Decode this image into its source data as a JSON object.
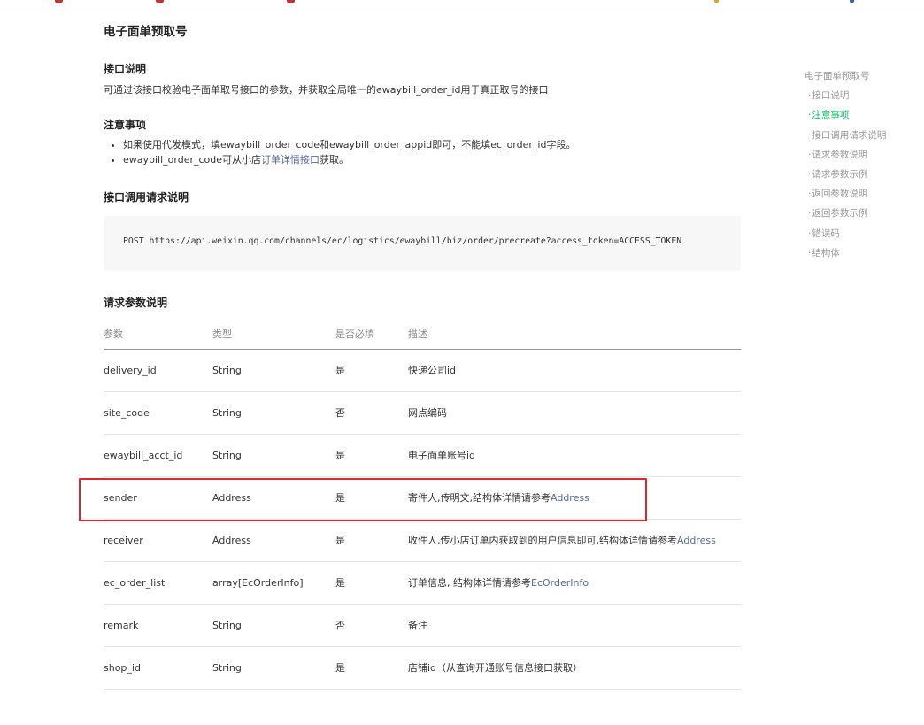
{
  "page": {
    "title": "电子面单预取号"
  },
  "sections": {
    "desc": {
      "heading": "接口说明",
      "text": "可通过该接口校验电子面单取号接口的参数，并获取全局唯一的ewaybill_order_id用于真正取号的接口"
    },
    "notes": {
      "heading": "注意事项",
      "item1": "如果使用代发模式，填ewaybill_order_code和ewaybill_order_appid即可，不能填ec_order_id字段。",
      "item2_prefix": "ewaybill_order_code可从小店",
      "item2_link": "订单详情接口",
      "item2_suffix": "获取。"
    },
    "request": {
      "heading": "接口调用请求说明",
      "code": "POST https://api.weixin.qq.com/channels/ec/logistics/ewaybill/biz/order/precreate?access_token=ACCESS_TOKEN"
    },
    "params": {
      "heading": "请求参数说明",
      "columns": [
        "参数",
        "类型",
        "是否必填",
        "描述"
      ],
      "rows": [
        {
          "name": "delivery_id",
          "type": "String",
          "required": "是",
          "desc": "快递公司id",
          "link": ""
        },
        {
          "name": "site_code",
          "type": "String",
          "required": "否",
          "desc": "网点编码",
          "link": ""
        },
        {
          "name": "ewaybill_acct_id",
          "type": "String",
          "required": "是",
          "desc": "电子面单账号id",
          "link": ""
        },
        {
          "name": "sender",
          "type": "Address",
          "required": "是",
          "desc": "寄件人,传明文,结构体详情请参考",
          "link": "Address"
        },
        {
          "name": "receiver",
          "type": "Address",
          "required": "是",
          "desc": "收件人,传小店订单内获取到的用户信息即可,结构体详情请参考",
          "link": "Address"
        },
        {
          "name": "ec_order_list",
          "type": "array[EcOrderInfo]",
          "required": "是",
          "desc": "订单信息, 结构体详情请参考",
          "link": "EcOrderInfo"
        },
        {
          "name": "remark",
          "type": "String",
          "required": "否",
          "desc": "备注",
          "link": ""
        },
        {
          "name": "shop_id",
          "type": "String",
          "required": "是",
          "desc": "店铺id（从查询开通账号信息接口获取）",
          "link": ""
        }
      ]
    },
    "next_heading": ""
  },
  "toc": {
    "root": "电子面单预取号",
    "items": [
      {
        "label": "接口说明",
        "active": false
      },
      {
        "label": "注意事项",
        "active": true
      },
      {
        "label": "接口调用请求说明",
        "active": false
      },
      {
        "label": "请求参数说明",
        "active": false
      },
      {
        "label": "请求参数示例",
        "active": false
      },
      {
        "label": "返回参数说明",
        "active": false
      },
      {
        "label": "返回参数示例",
        "active": false
      },
      {
        "label": "错误码",
        "active": false
      },
      {
        "label": "结构体",
        "active": false
      }
    ]
  },
  "colors": {
    "accent": "#07c160",
    "link": "#576b95",
    "highlight": "#d9282f"
  }
}
